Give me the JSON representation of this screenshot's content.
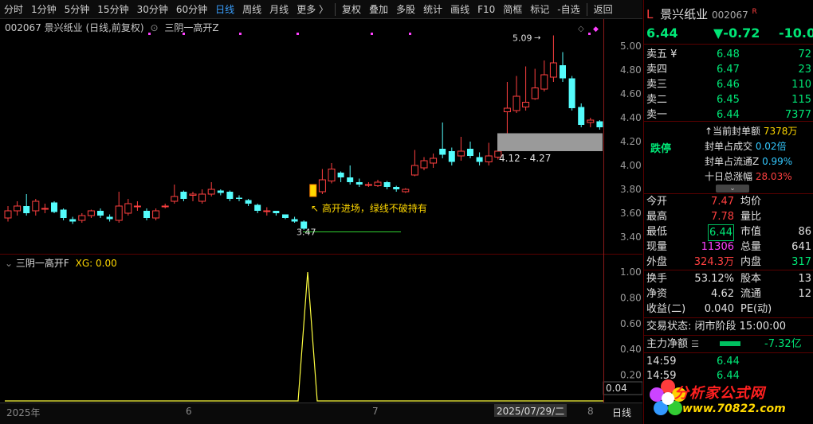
{
  "toolbar": {
    "items": [
      "分时",
      "1分钟",
      "5分钟",
      "15分钟",
      "30分钟",
      "60分钟",
      "日线",
      "周线",
      "月线",
      "更多 〉",
      "复权",
      "叠加",
      "多股",
      "统计",
      "画线",
      "F10",
      "简框",
      "标记",
      "-自选",
      "返回"
    ],
    "active": "日线"
  },
  "main_title": {
    "code_name": "002067  景兴纸业 (日线,前复权)",
    "indicator": "三阴一高开Z"
  },
  "sub_title": {
    "indicator": "三阴一高开F",
    "xg_label": "XG: 0.00"
  },
  "annotations": {
    "high_label": "5.09",
    "low_label": "3.47",
    "entry_note": "↖ 高开进场，绿线不破持有",
    "range_label": "4.12 - 4.27"
  },
  "price_axis": [
    "5.00",
    "4.80",
    "4.60",
    "4.40",
    "4.20",
    "4.00",
    "3.80",
    "3.60",
    "3.40"
  ],
  "sub_axis": [
    "1.00",
    "0.80",
    "0.60",
    "0.40",
    "0.20",
    "0.04"
  ],
  "bottom_axis": {
    "year": "2025年",
    "m6": "6",
    "m7": "7",
    "m8": "8",
    "cursor_date": "2025/07/29/二",
    "period": "日线"
  },
  "panel": {
    "title_prefix": "L",
    "stock_name": "景兴纸业",
    "stock_code": "002067",
    "r_mark": "R",
    "price": "6.44",
    "change": "▼-0.72",
    "change_pct": "-10.0",
    "asks": [
      {
        "label": "卖五 ¥",
        "price": "6.48",
        "vol": "72"
      },
      {
        "label": "卖四",
        "price": "6.47",
        "vol": "23"
      },
      {
        "label": "卖三",
        "price": "6.46",
        "vol": "110"
      },
      {
        "label": "卖二",
        "price": "6.45",
        "vol": "115"
      },
      {
        "label": "卖一",
        "price": "6.44",
        "vol": "7377"
      }
    ],
    "limit_status": "跌停",
    "seal": [
      {
        "label": "↑当前封单额",
        "value": "7378万"
      },
      {
        "label": "封单占成交",
        "value": "0.02倍"
      },
      {
        "label": "封单占流通Z",
        "value": "0.99%"
      },
      {
        "label": "十日总涨幅",
        "value": "28.03%"
      }
    ],
    "stats_left": [
      {
        "label": "今开",
        "value": "7.47"
      },
      {
        "label": "最高",
        "value": "7.78"
      },
      {
        "label": "最低",
        "value": "6.44"
      },
      {
        "label": "现量",
        "value": "11306"
      },
      {
        "label": "外盘",
        "value": "324.3万"
      }
    ],
    "stats_right": [
      {
        "label": "均价",
        "value": ""
      },
      {
        "label": "量比",
        "value": ""
      },
      {
        "label": "市值",
        "value": "86"
      },
      {
        "label": "总量",
        "value": "641"
      },
      {
        "label": "内盘",
        "value": "317"
      }
    ],
    "stats2": [
      {
        "l1": "换手",
        "v1": "53.12%",
        "l2": "股本",
        "v2": "13"
      },
      {
        "l1": "净资",
        "v1": "4.62",
        "l2": "流通",
        "v2": "12"
      },
      {
        "l1": "收益(二)",
        "v1": "0.040",
        "l2": "PE(动)",
        "v2": ""
      }
    ],
    "trade_status": "交易状态: 闭市阶段 15:00:00",
    "main_flow_label": "主力净额",
    "main_flow_value": "-7.32亿",
    "ticks": [
      {
        "time": "14:59",
        "price": "6.44"
      },
      {
        "time": "14:59",
        "price": "6.44"
      }
    ]
  },
  "watermark": {
    "name": "分析家公式网",
    "url": "www.70822.com"
  }
}
